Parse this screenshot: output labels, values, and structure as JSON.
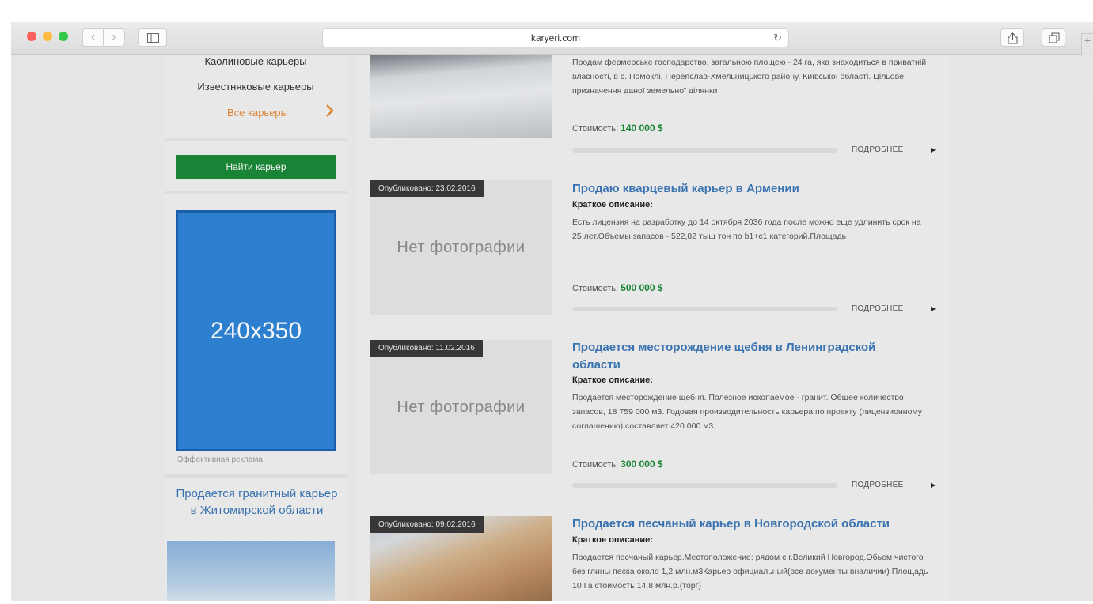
{
  "browser": {
    "url": "karyeri.com"
  },
  "sidebar": {
    "categories": [
      "Каолиновые карьеры",
      "Известняковые карьеры"
    ],
    "all_label": "Все карьеры",
    "find_button": "Найти карьер",
    "ad_size_label": "240x350",
    "ad_caption": "Эффективная реклама",
    "featured_title": "Продается гранитный карьер в Житомирской области"
  },
  "listings": [
    {
      "published": "",
      "title": "",
      "subtitle": "",
      "description": "Продам фермерське господарство, загальною площею - 24 га, яка знаходиться в приватній власності, в с. Помоклі, Переяслав-Хмельницького району, Київської області. Цільове призначення даної земельної ділянки",
      "price_label": "Стоимость:",
      "price": "140 000 $",
      "more": "ПОДРОБНЕЕ"
    },
    {
      "published": "Опубликовано: 23.02.2016",
      "no_photo": "Нет фотографии",
      "title": "Продаю кварцевый карьер в Армении",
      "subtitle": "Краткое описание:",
      "description": "Есть лицензия на разработку до 14 октября 2036 года после можно еще удлинить срок на 25 лет.Объемы запасов - 522,82 тыщ тон по b1+c1 категорий.Площадь",
      "price_label": "Стоимость:",
      "price": "500 000 $",
      "more": "ПОДРОБНЕЕ"
    },
    {
      "published": "Опубликовано: 11.02.2016",
      "no_photo": "Нет фотографии",
      "title": "Продается месторождение щебня в Ленинградской области",
      "subtitle": "Краткое описание:",
      "description": "Продается месторождение щебня. Полезное ископаемое - гранит. Общее количество запасов, 18 759 000 м3. Годовая производительность карьера по проекту (лицензионному соглашению) составляет 420 000 м3.",
      "price_label": "Стоимость:",
      "price": "300 000 $",
      "more": "ПОДРОБНЕЕ"
    },
    {
      "published": "Опубликовано: 09.02.2016",
      "title": "Продается песчаный карьер в Новгородской области",
      "subtitle": "Краткое описание:",
      "description": "Продается песчаный карьер.Местоположение: рядом с г.Великий Новгород.Обьем чистого без глины песка около 1,2 млн.м3Карьер официальный(все документы вналичии) Площадь 10 Га стоимость 14,8 млн.р.(торг)",
      "price_label": "",
      "price": "",
      "more": ""
    }
  ]
}
